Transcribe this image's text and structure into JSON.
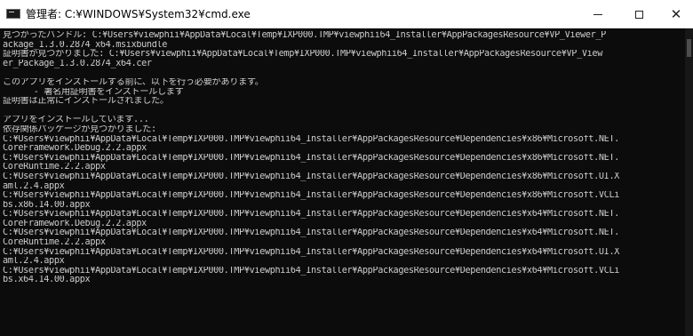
{
  "window": {
    "title": "管理者: C:¥WINDOWS¥System32¥cmd.exe",
    "minimize_label": "—",
    "maximize_label": "□",
    "close_label": "✕"
  },
  "console": {
    "lines": [
      "見つかったバンドル: C:¥Users¥viewphii¥AppData¥Local¥Temp¥IXP000.TMP¥viewphii64_Installer¥AppPackagesResource¥VP_Viewer_P",
      "ackage_1.3.0.2874_x64.msixbundle",
      "証明書が見つかりました: C:¥Users¥viewphii¥AppData¥Local¥Temp¥IXP000.TMP¥viewphii64_Installer¥AppPackagesResource¥VP_View",
      "er_Package_1.3.0.2874_x64.cer",
      "",
      "このアプリをインストールする前に、以下を行う必要があります。",
      "      - 署名用証明書をインストールします",
      "証明書は正常にインストールされました。",
      "",
      "アプリをインストールしています...",
      "依存関係パッケージが見つかりました:",
      "C:¥Users¥viewphii¥AppData¥Local¥Temp¥IXP000.TMP¥viewphii64_Installer¥AppPackagesResource¥Dependencies¥x86¥Microsoft.NET.",
      "CoreFramework.Debug.2.2.appx",
      "C:¥Users¥viewphii¥AppData¥Local¥Temp¥IXP000.TMP¥viewphii64_Installer¥AppPackagesResource¥Dependencies¥x86¥Microsoft.NET.",
      "CoreRuntime.2.2.appx",
      "C:¥Users¥viewphii¥AppData¥Local¥Temp¥IXP000.TMP¥viewphii64_Installer¥AppPackagesResource¥Dependencies¥x86¥Microsoft.UI.X",
      "aml.2.4.appx",
      "C:¥Users¥viewphii¥AppData¥Local¥Temp¥IXP000.TMP¥viewphii64_Installer¥AppPackagesResource¥Dependencies¥x86¥Microsoft.VCLi",
      "bs.x86.14.00.appx",
      "C:¥Users¥viewphii¥AppData¥Local¥Temp¥IXP000.TMP¥viewphii64_Installer¥AppPackagesResource¥Dependencies¥x64¥Microsoft.NET.",
      "CoreFramework.Debug.2.2.appx",
      "C:¥Users¥viewphii¥AppData¥Local¥Temp¥IXP000.TMP¥viewphii64_Installer¥AppPackagesResource¥Dependencies¥x64¥Microsoft.NET.",
      "CoreRuntime.2.2.appx",
      "C:¥Users¥viewphii¥AppData¥Local¥Temp¥IXP000.TMP¥viewphii64_Installer¥AppPackagesResource¥Dependencies¥x64¥Microsoft.UI.X",
      "aml.2.4.appx",
      "C:¥Users¥viewphii¥AppData¥Local¥Temp¥IXP000.TMP¥viewphii64_Installer¥AppPackagesResource¥Dependencies¥x64¥Microsoft.VCLi",
      "bs.x64.14.00.appx"
    ]
  },
  "icons": {
    "app": "console-app-icon"
  },
  "colors": {
    "console_background": "#0c0c0c",
    "console_text": "#cccccc",
    "titlebar_background": "#ffffff"
  }
}
